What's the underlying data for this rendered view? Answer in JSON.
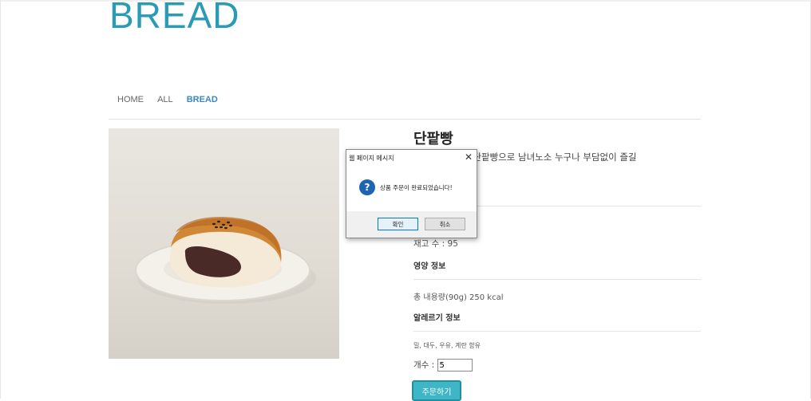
{
  "site": {
    "logo": "BREAD"
  },
  "nav": {
    "items": [
      "HOME",
      "ALL",
      "BREAD"
    ],
    "active": "BREAD"
  },
  "product": {
    "name": "단팥빵",
    "description": "이 함유된 정통 단팥빵으로 남녀노소 누구나 부담없이 즐길",
    "stock_text": "재고 수 : 95",
    "nutrition_header": "영양 정보",
    "nutrition_text": "총 내용량(90g) 250 kcal",
    "allergy_header": "알레르기 정보",
    "allergy_text": "밀, 대두, 우유, 계란 함유",
    "qty_label": "개수 :",
    "qty_value": "5",
    "order_button": "주문하기"
  },
  "dialog": {
    "title": "웹 페이지 메시지",
    "message": "상품 주문이 완료되었습니다!",
    "ok": "확인",
    "cancel": "취소",
    "icon": "question-icon",
    "icon_glyph": "?"
  },
  "colors": {
    "accent": "#2a9bb5",
    "nav_active": "#3a87c8",
    "button": "#3fb6c6",
    "dialog_icon": "#1f63b3"
  }
}
